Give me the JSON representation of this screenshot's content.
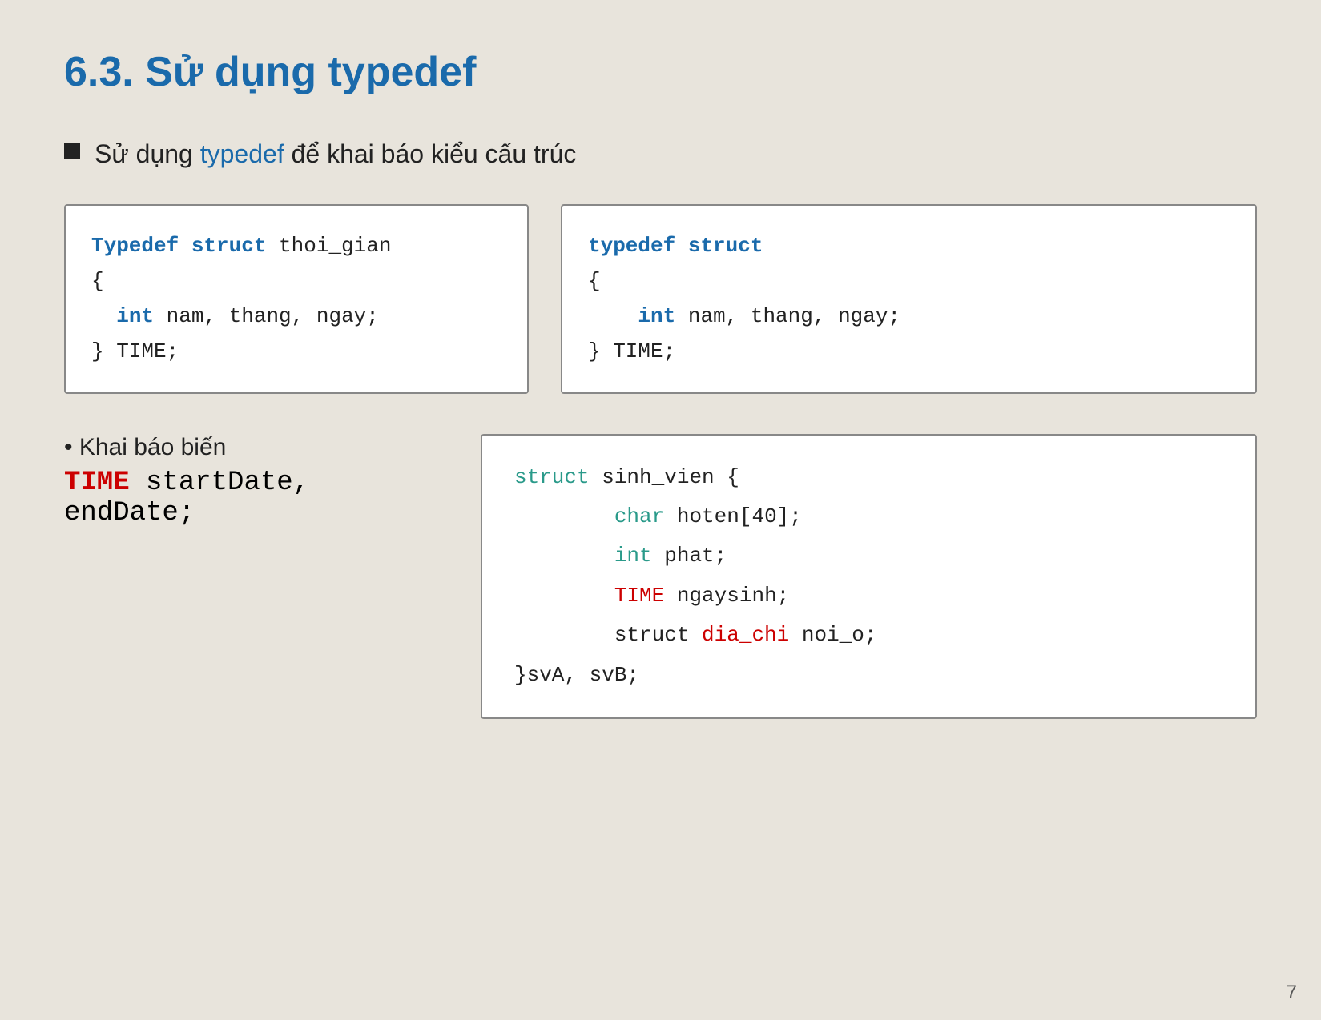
{
  "slide": {
    "title": "6.3. Sử dụng typedef",
    "bullet": {
      "prefix": "Sử dụng",
      "keyword": "typedef",
      "suffix": "để khai báo kiểu cấu trúc"
    },
    "code_left": {
      "lines": [
        {
          "parts": [
            {
              "text": "Typedef struct",
              "class": "kw-blue"
            },
            {
              "text": " thoi_gian",
              "class": "text-normal"
            }
          ]
        },
        {
          "parts": [
            {
              "text": "{",
              "class": "text-normal"
            }
          ]
        },
        {
          "parts": [
            {
              "text": "  ",
              "class": "text-normal"
            },
            {
              "text": "int",
              "class": "kw-int"
            },
            {
              "text": " nam, thang, ngay;",
              "class": "text-normal"
            }
          ]
        },
        {
          "parts": [
            {
              "text": "} TIME;",
              "class": "text-normal"
            }
          ]
        }
      ]
    },
    "code_right": {
      "lines": [
        {
          "parts": [
            {
              "text": "typedef struct",
              "class": "kw-blue"
            }
          ]
        },
        {
          "parts": [
            {
              "text": "{",
              "class": "text-normal"
            }
          ]
        },
        {
          "parts": [
            {
              "text": "    ",
              "class": "text-normal"
            },
            {
              "text": "int",
              "class": "kw-int"
            },
            {
              "text": " nam, thang, ngay;",
              "class": "text-normal"
            }
          ]
        },
        {
          "parts": [
            {
              "text": "} TIME;",
              "class": "text-normal"
            }
          ]
        }
      ]
    },
    "khai_bao": {
      "title": "• Khai báo biến",
      "time_label": "TIME",
      "rest": " startDate, endDate;"
    },
    "struct_box": {
      "lines": [
        {
          "parts": [
            {
              "text": "struct",
              "class": "kw-teal"
            },
            {
              "text": " sinh_vien {",
              "class": "text-normal"
            }
          ]
        },
        {
          "parts": [
            {
              "text": "        ",
              "class": "text-normal"
            },
            {
              "text": "char",
              "class": "kw-teal"
            },
            {
              "text": " hoten[40];",
              "class": "text-normal"
            }
          ]
        },
        {
          "parts": [
            {
              "text": "        ",
              "class": "text-normal"
            },
            {
              "text": "int",
              "class": "kw-teal"
            },
            {
              "text": " phat;",
              "class": "text-normal"
            }
          ]
        },
        {
          "parts": [
            {
              "text": "        ",
              "class": "text-normal"
            },
            {
              "text": "TIME",
              "class": "kw-red"
            },
            {
              "text": " ngaysinh;",
              "class": "text-normal"
            }
          ]
        },
        {
          "parts": [
            {
              "text": "        ",
              "class": "text-normal"
            },
            {
              "text": "struct",
              "class": "text-normal"
            },
            {
              "text": " dia_chi",
              "class": "kw-red"
            },
            {
              "text": " noi_o;",
              "class": "text-normal"
            }
          ]
        },
        {
          "parts": [
            {
              "text": "}svA, svB;",
              "class": "text-normal"
            }
          ]
        }
      ]
    },
    "page_number": "7"
  }
}
